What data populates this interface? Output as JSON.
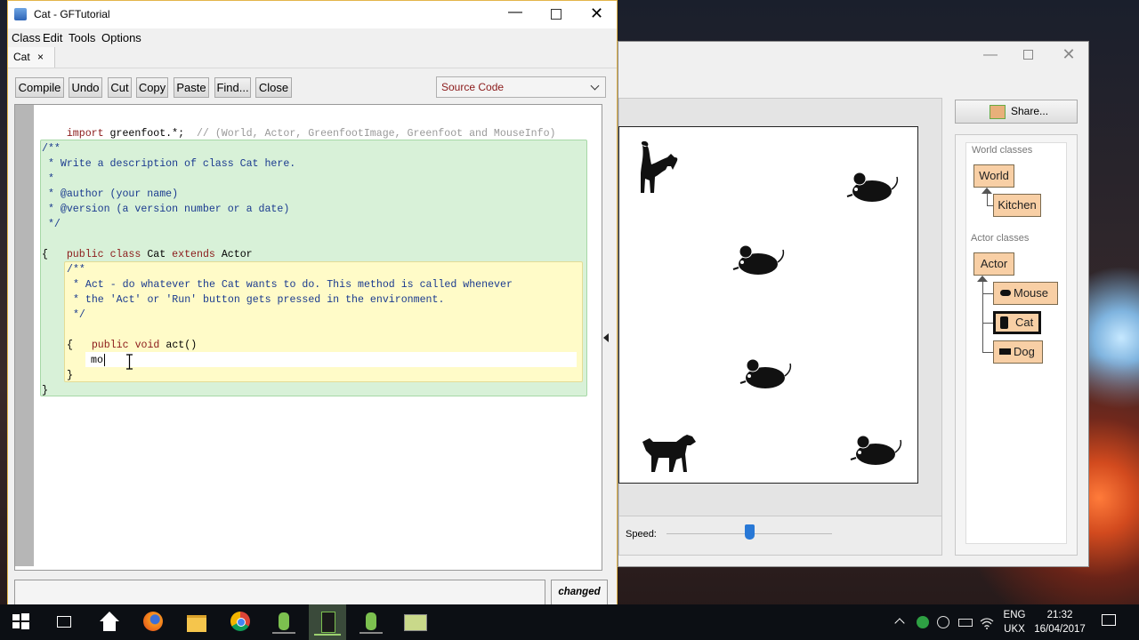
{
  "editor": {
    "title": "Cat - GFTutorial",
    "menu": [
      "Class",
      "Edit",
      "Tools",
      "Options"
    ],
    "tab_label": "Cat",
    "tab_close": "×",
    "buttons": {
      "compile": "Compile",
      "undo": "Undo",
      "cut": "Cut",
      "copy": "Copy",
      "paste": "Paste",
      "find": "Find...",
      "close": "Close"
    },
    "view_select": "Source Code",
    "code": {
      "import_kw": "import",
      "import_pkg": " greenfoot.*;",
      "import_comment": "// (World, Actor, GreenfootImage, Greenfoot and MouseInfo)",
      "class_comment": [
        "/**",
        " * Write a description of class Cat here.",
        " * ",
        " * @author (your name)",
        " * @version (a version number or a date)",
        " */"
      ],
      "class_kw_public": "public",
      "class_kw_class": "class",
      "class_name": "Cat",
      "class_kw_extends": "extends",
      "class_super": "Actor",
      "open_brace": "{",
      "close_brace": "}",
      "method_comment": [
        "/**",
        " * Act - do whatever the Cat wants to do. This method is called whenever",
        " * the 'Act' or 'Run' button gets pressed in the environment.",
        " */"
      ],
      "method_kw_public": "public",
      "method_kw_void": "void",
      "method_sig": "act()",
      "typed": "mo"
    },
    "status": "changed"
  },
  "scenario": {
    "share_label": "Share...",
    "world_classes_label": "World classes",
    "world_classes": [
      "World",
      "Kitchen"
    ],
    "actor_classes_label": "Actor classes",
    "actor_root": "Actor",
    "actor_classes": [
      "Mouse",
      "Cat",
      "Dog"
    ],
    "selected_class": "Cat",
    "speed_label": "Speed:",
    "speed_value": 0.5
  },
  "taskbar": {
    "language": "ENG",
    "keyboard": "UKX",
    "time": "21:32",
    "date": "16/04/2017"
  },
  "colors": {
    "class_box": "#f8cfa5",
    "comment_green": "#d8f1d8",
    "method_yellow": "#fffbc8",
    "keyword": "#8b1a1a",
    "comment_text": "#1a3a8f",
    "taskbar": "#0c0f14"
  }
}
